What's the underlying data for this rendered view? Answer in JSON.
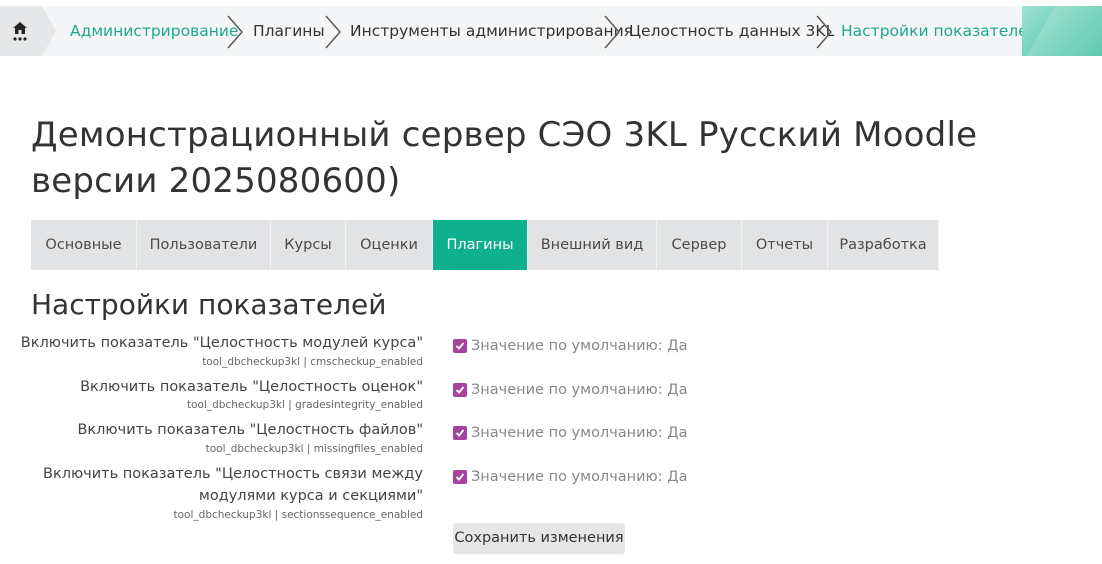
{
  "breadcrumb": {
    "home_icon": "home-icon",
    "items": [
      "Администрирование",
      "Плагины",
      "Инструменты администрирования",
      "Целостность данных 3KL",
      "Настройки показателей"
    ]
  },
  "site_title": "Демонстрационный сервер СЭО 3KL Русский Moodle версии 2025080600)",
  "tabs": [
    "Основные",
    "Пользователи",
    "Курсы",
    "Оценки",
    "Плагины",
    "Внешний вид",
    "Сервер",
    "Отчеты",
    "Разработка"
  ],
  "active_tab": "Плагины",
  "page_heading": "Настройки показателей",
  "settings": [
    {
      "label": "Включить показатель \"Целостность модулей курса\"",
      "key": "tool_dbcheckup3kl | cmscheckup_enabled",
      "checked": true,
      "default": "Значение по умолчанию: Да"
    },
    {
      "label": "Включить показатель \"Целостность оценок\"",
      "key": "tool_dbcheckup3kl | gradesintegrity_enabled",
      "checked": true,
      "default": "Значение по умолчанию: Да"
    },
    {
      "label": "Включить показатель \"Целостность файлов\"",
      "key": "tool_dbcheckup3kl | missingfiles_enabled",
      "checked": true,
      "default": "Значение по умолчанию: Да"
    },
    {
      "label_line1": "Включить показатель \"Целостность связи между",
      "label_line2": "модулями курса и секциями\"",
      "key": "tool_dbcheckup3kl | sectionssequence_enabled",
      "checked": true,
      "default": "Значение по умолчанию: Да"
    }
  ],
  "save_label": "Сохранить изменения",
  "colors": {
    "accent": "#0fb08d",
    "link": "#1ea88c",
    "checkbox": "#a4449c"
  }
}
